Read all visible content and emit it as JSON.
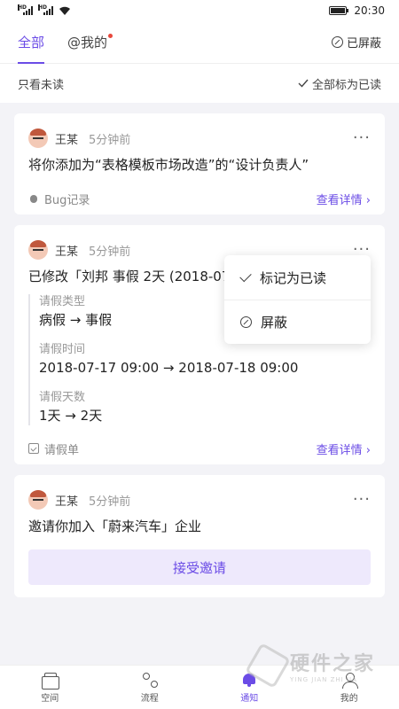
{
  "status_bar": {
    "time": "20:30",
    "sim1": "HD",
    "sim2": "HD"
  },
  "tabs": {
    "all": "全部",
    "mentions": "@我的",
    "blocked": "已屏蔽"
  },
  "filter": {
    "unread_only": "只看未读",
    "mark_all_read": "全部标为已读"
  },
  "cards": [
    {
      "user": "王某",
      "time": "5分钟前",
      "title": "将你添加为“表格模板市场改造”的“设计负责人”",
      "source": "Bug记录",
      "detail": "查看详情"
    },
    {
      "user": "王某",
      "time": "5分钟前",
      "title": "已修改「刘邦 事假 2天 (2018-07",
      "changes": [
        {
          "label": "请假类型",
          "value": "病假 → 事假"
        },
        {
          "label": "请假时间",
          "value": "2018-07-17 09:00 → 2018-07-18 09:00"
        },
        {
          "label": "请假天数",
          "value": "1天 → 2天"
        }
      ],
      "source": "请假单",
      "detail": "查看详情"
    },
    {
      "user": "王某",
      "time": "5分钟前",
      "title": "邀请你加入「蔚来汽车」企业",
      "button": "接受邀请"
    }
  ],
  "more_glyph": "···",
  "popup": {
    "mark_read": "标记为已读",
    "block": "屏蔽"
  },
  "nav": [
    {
      "label": "空间",
      "icon": "space-icon"
    },
    {
      "label": "流程",
      "icon": "flow-icon"
    },
    {
      "label": "通知",
      "icon": "bell-icon"
    },
    {
      "label": "我的",
      "icon": "user-icon"
    }
  ],
  "watermark": {
    "name": "硬件之家",
    "pinyin": "YING JIAN ZHI JIA"
  },
  "colors": {
    "accent": "#6b4ce6",
    "badge": "#e8483c",
    "accept_bg": "#eee9fc"
  }
}
